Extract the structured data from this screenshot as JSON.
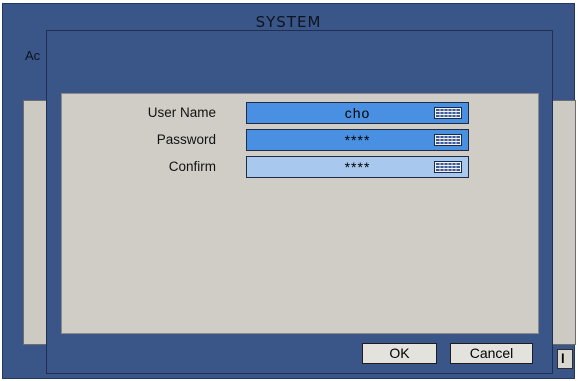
{
  "background_window": {
    "title": "SYSTEM",
    "tab_label_partial": "Ac",
    "button_partial": "l"
  },
  "dialog": {
    "fields": [
      {
        "label": "User Name",
        "value": "cho",
        "state": "active",
        "icon": "keyboard-icon"
      },
      {
        "label": "Password",
        "value": "****",
        "state": "active",
        "icon": "keyboard-icon"
      },
      {
        "label": "Confirm",
        "value": "****",
        "state": "inactive",
        "icon": "keyboard-icon"
      }
    ],
    "buttons": {
      "ok": "OK",
      "cancel": "Cancel"
    }
  },
  "colors": {
    "window_blue": "#3a5587",
    "panel_gray": "#d0cdc6",
    "field_active": "#4a90e2",
    "field_inactive": "#a8c8ee"
  }
}
